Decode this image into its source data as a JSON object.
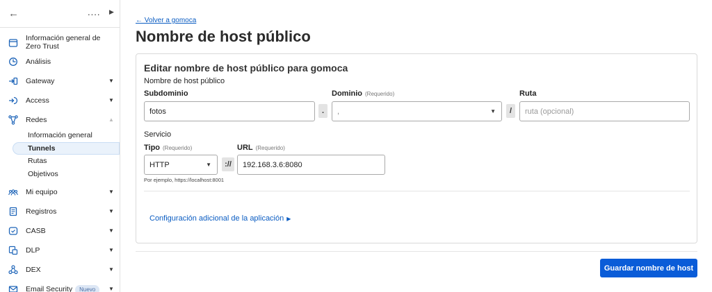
{
  "sidebar": {
    "account": "....",
    "items": [
      {
        "label": "Información general de Zero Trust",
        "icon": "panel-icon",
        "caret": ""
      },
      {
        "label": "Análisis",
        "icon": "clock-chart-icon",
        "caret": ""
      },
      {
        "label": "Gateway",
        "icon": "gateway-icon",
        "caret": "▼"
      },
      {
        "label": "Access",
        "icon": "login-icon",
        "caret": "▼"
      },
      {
        "label": "Redes",
        "icon": "network-icon",
        "caret": "▲"
      },
      {
        "label": "Mi equipo",
        "icon": "team-icon",
        "caret": "▼"
      },
      {
        "label": "Registros",
        "icon": "document-icon",
        "caret": "▼"
      },
      {
        "label": "CASB",
        "icon": "shield-check-icon",
        "caret": "▼"
      },
      {
        "label": "DLP",
        "icon": "data-icon",
        "caret": "▼"
      },
      {
        "label": "DEX",
        "icon": "nodes-icon",
        "caret": "▼"
      },
      {
        "label": "Email Security",
        "icon": "mail-icon",
        "caret": "▼",
        "badge": "Nuevo"
      }
    ],
    "redes_sub": [
      "Información general",
      "Tunnels",
      "Rutas",
      "Objetivos"
    ]
  },
  "main": {
    "back_link": "← Volver a gomoca",
    "title": "Nombre de host público",
    "card": {
      "title": "Editar nombre de host público para gomoca",
      "section_hostname": "Nombre de host público",
      "subdomain": {
        "label": "Subdominio",
        "value": "fotos"
      },
      "dot": ".",
      "domain": {
        "label": "Dominio",
        "required": "(Requerido)",
        "value": ","
      },
      "slash": "/",
      "path": {
        "label": "Ruta",
        "placeholder": "ruta (opcional)"
      },
      "section_service": "Servicio",
      "type": {
        "label": "Tipo",
        "required": "(Requerido)",
        "value": "HTTP"
      },
      "scheme_sep": "://",
      "url": {
        "label": "URL",
        "required": "(Requerido)",
        "value": "192.168.3.6:8080"
      },
      "hint": "Por ejemplo, https://localhost:8001",
      "advanced": "Configuración adicional de la aplicación"
    },
    "save_button": "Guardar nombre de host"
  },
  "colors": {
    "accent": "#0a5cd8",
    "link": "#0a5cc2",
    "icon": "#1c63b8"
  }
}
